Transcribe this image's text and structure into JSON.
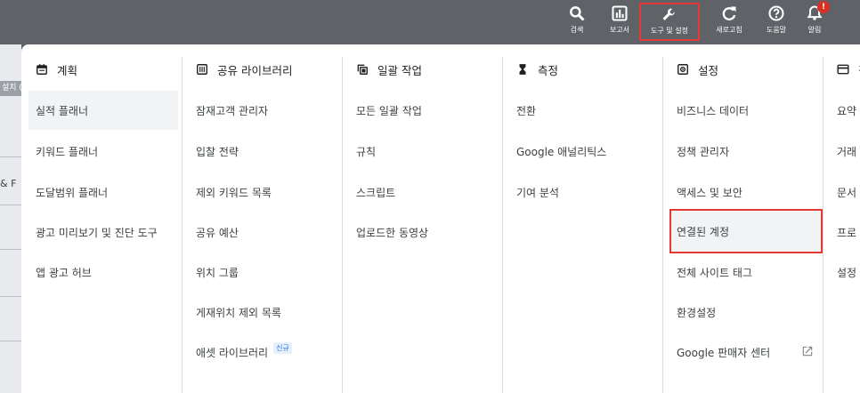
{
  "toolbar": {
    "items": [
      {
        "label": "검색",
        "icon": "search-icon"
      },
      {
        "label": "보고서",
        "icon": "reports-icon"
      },
      {
        "label": "도구 및 설정",
        "icon": "wrench-icon"
      },
      {
        "label": "새로고침",
        "icon": "refresh-icon"
      },
      {
        "label": "도움말",
        "icon": "help-icon"
      },
      {
        "label": "알림",
        "icon": "bell-icon",
        "badge": "!"
      }
    ]
  },
  "background": {
    "tag_text": "설치 (",
    "row_text": "& F"
  },
  "menu": {
    "columns": [
      {
        "header": "계획",
        "icon": "calendar-icon",
        "items": [
          "실적 플래너",
          "키워드 플래너",
          "도달범위 플래너",
          "광고 미리보기 및 진단 도구",
          "앱 광고 허브"
        ]
      },
      {
        "header": "공유 라이브러리",
        "icon": "library-icon",
        "items": [
          "잠재고객 관리자",
          "입찰 전략",
          "제외 키워드 목록",
          "공유 예산",
          "위치 그룹",
          "게재위치 제외 목록",
          "애셋 라이브러리"
        ],
        "new_badge": "신규"
      },
      {
        "header": "일괄 작업",
        "icon": "copy-icon",
        "items": [
          "모든 일괄 작업",
          "규칙",
          "스크립트",
          "업로드한 동영상"
        ]
      },
      {
        "header": "측정",
        "icon": "hourglass-icon",
        "items": [
          "전환",
          "Google 애널리틱스",
          "기여 분석"
        ]
      },
      {
        "header": "설정",
        "icon": "settings-icon",
        "items": [
          "비즈니스 데이터",
          "정책 관리자",
          "액세스 및 보안",
          "연결된 계정",
          "전체 사이트 태그",
          "환경설정",
          "Google 판매자 센터"
        ]
      },
      {
        "header": "결",
        "icon": "billing-icon",
        "items": [
          "요약",
          "거래",
          "문서",
          "프로",
          "설정"
        ]
      }
    ]
  },
  "colors": {
    "toolbar_bg": "#5f6368",
    "highlight_border": "#e53935",
    "new_badge": "#1a73e8",
    "selected_bg": "#f1f3f4"
  }
}
